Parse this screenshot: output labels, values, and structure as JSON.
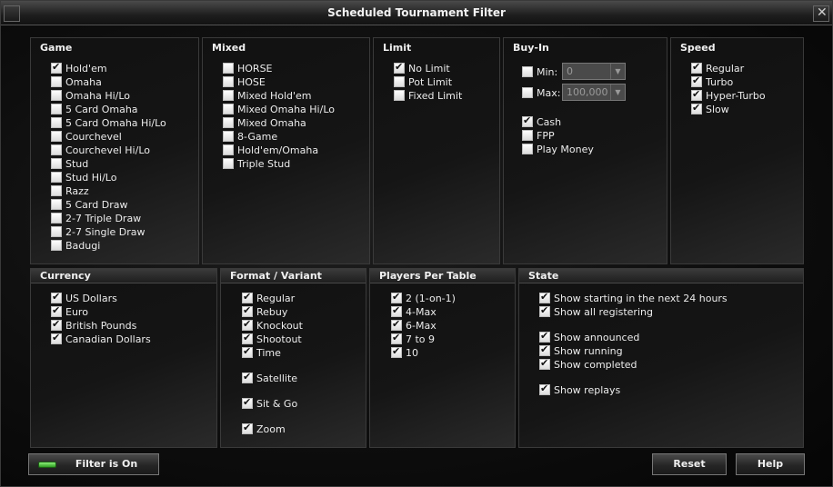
{
  "window": {
    "title": "Scheduled Tournament Filter"
  },
  "game": {
    "title": "Game",
    "items": [
      {
        "label": "Hold'em",
        "checked": true
      },
      {
        "label": "Omaha",
        "checked": false
      },
      {
        "label": "Omaha Hi/Lo",
        "checked": false
      },
      {
        "label": "5 Card Omaha",
        "checked": false
      },
      {
        "label": "5 Card Omaha Hi/Lo",
        "checked": false
      },
      {
        "label": "Courchevel",
        "checked": false
      },
      {
        "label": "Courchevel Hi/Lo",
        "checked": false
      },
      {
        "label": "Stud",
        "checked": false
      },
      {
        "label": "Stud Hi/Lo",
        "checked": false
      },
      {
        "label": "Razz",
        "checked": false
      },
      {
        "label": "5 Card Draw",
        "checked": false
      },
      {
        "label": "2-7 Triple Draw",
        "checked": false
      },
      {
        "label": "2-7 Single Draw",
        "checked": false
      },
      {
        "label": "Badugi",
        "checked": false
      }
    ]
  },
  "mixed": {
    "title": "Mixed",
    "items": [
      {
        "label": "HORSE",
        "checked": false
      },
      {
        "label": "HOSE",
        "checked": false
      },
      {
        "label": "Mixed Hold'em",
        "checked": false
      },
      {
        "label": "Mixed Omaha Hi/Lo",
        "checked": false
      },
      {
        "label": "Mixed Omaha",
        "checked": false
      },
      {
        "label": "8-Game",
        "checked": false
      },
      {
        "label": "Hold'em/Omaha",
        "checked": false
      },
      {
        "label": "Triple Stud",
        "checked": false
      }
    ]
  },
  "limit": {
    "title": "Limit",
    "items": [
      {
        "label": "No Limit",
        "checked": true
      },
      {
        "label": "Pot Limit",
        "checked": false
      },
      {
        "label": "Fixed Limit",
        "checked": false
      }
    ]
  },
  "buyin": {
    "title": "Buy-In",
    "min": {
      "label": "Min:",
      "checked": false,
      "value": "0"
    },
    "max": {
      "label": "Max:",
      "checked": false,
      "value": "100,000"
    },
    "items": [
      {
        "label": "Cash",
        "checked": true
      },
      {
        "label": "FPP",
        "checked": false
      },
      {
        "label": "Play Money",
        "checked": false
      }
    ]
  },
  "speed": {
    "title": "Speed",
    "items": [
      {
        "label": "Regular",
        "checked": true
      },
      {
        "label": "Turbo",
        "checked": true
      },
      {
        "label": "Hyper-Turbo",
        "checked": true
      },
      {
        "label": "Slow",
        "checked": true
      }
    ]
  },
  "currency": {
    "title": "Currency",
    "items": [
      {
        "label": "US Dollars",
        "checked": true
      },
      {
        "label": "Euro",
        "checked": true
      },
      {
        "label": "British Pounds",
        "checked": true
      },
      {
        "label": "Canadian Dollars",
        "checked": true
      }
    ]
  },
  "format": {
    "title": "Format / Variant",
    "items": [
      {
        "label": "Regular",
        "checked": true
      },
      {
        "label": "Rebuy",
        "checked": true
      },
      {
        "label": "Knockout",
        "checked": true
      },
      {
        "label": "Shootout",
        "checked": true
      },
      {
        "label": "Time",
        "checked": true
      },
      {
        "label": "Satellite",
        "checked": true
      },
      {
        "label": "Sit & Go",
        "checked": true
      },
      {
        "label": "Zoom",
        "checked": true
      }
    ]
  },
  "players": {
    "title": "Players Per Table",
    "items": [
      {
        "label": "2 (1-on-1)",
        "checked": true
      },
      {
        "label": "4-Max",
        "checked": true
      },
      {
        "label": "6-Max",
        "checked": true
      },
      {
        "label": "7 to 9",
        "checked": true
      },
      {
        "label": "10",
        "checked": true
      }
    ]
  },
  "state": {
    "title": "State",
    "items": [
      {
        "label": "Show starting in the next 24 hours",
        "checked": true
      },
      {
        "label": "Show all registering",
        "checked": true
      },
      {
        "label": "Show announced",
        "checked": true
      },
      {
        "label": "Show running",
        "checked": true
      },
      {
        "label": "Show completed",
        "checked": true
      },
      {
        "label": "Show replays",
        "checked": true
      }
    ]
  },
  "footer": {
    "filter_label": "Filter is On",
    "reset_label": "Reset",
    "help_label": "Help"
  },
  "colors": {
    "led": "#3fbf2f",
    "background": "#0d0d0d"
  }
}
